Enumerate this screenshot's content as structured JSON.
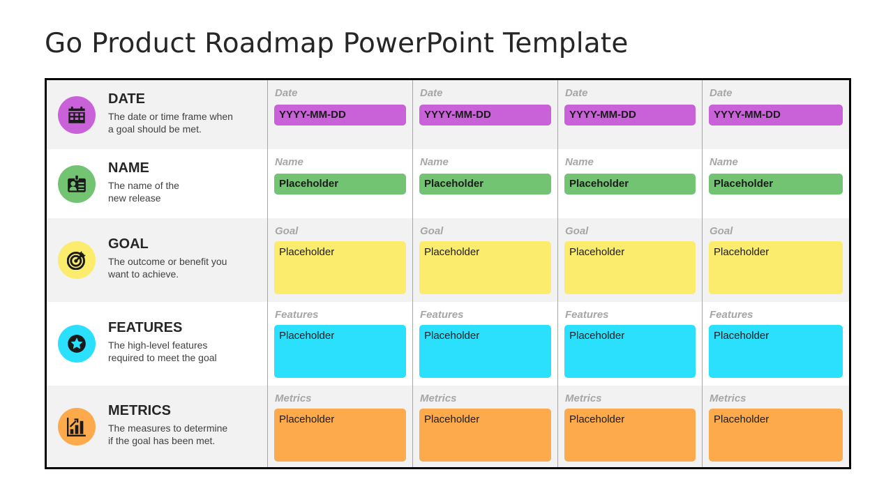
{
  "slide": {
    "title": "Go Product Roadmap PowerPoint Template"
  },
  "colors": {
    "date": "#c962d9",
    "name": "#72c473",
    "goal": "#fbec6d",
    "features": "#2ae0fd",
    "metrics": "#fdaa4d"
  },
  "rows": [
    {
      "key": "date",
      "title": "DATE",
      "desc1": "The date or time frame when",
      "desc2": "a goal should be met.",
      "icon": "calendar-icon",
      "cell_label": "Date",
      "cells": [
        "YYYY-MM-DD",
        "YYYY-MM-DD",
        "YYYY-MM-DD",
        "YYYY-MM-DD"
      ]
    },
    {
      "key": "name",
      "title": "NAME",
      "desc1": "The name of the",
      "desc2": "new release",
      "icon": "id-badge-icon",
      "cell_label": "Name",
      "cells": [
        "Placeholder",
        "Placeholder",
        "Placeholder",
        "Placeholder"
      ]
    },
    {
      "key": "goal",
      "title": "GOAL",
      "desc1": "The outcome or benefit you",
      "desc2": "want to achieve.",
      "icon": "target-icon",
      "cell_label": "Goal",
      "cells": [
        "Placeholder",
        "Placeholder",
        "Placeholder",
        "Placeholder"
      ]
    },
    {
      "key": "features",
      "title": "FEATURES",
      "desc1": "The high-level features",
      "desc2": "required to meet the goal",
      "icon": "star-icon",
      "cell_label": "Features",
      "cells": [
        "Placeholder",
        "Placeholder",
        "Placeholder",
        "Placeholder"
      ]
    },
    {
      "key": "metrics",
      "title": "METRICS",
      "desc1": "The measures to determine",
      "desc2": "if the goal has been met.",
      "icon": "bar-chart-icon",
      "cell_label": "Metrics",
      "cells": [
        "Placeholder",
        "Placeholder",
        "Placeholder",
        "Placeholder"
      ]
    }
  ]
}
